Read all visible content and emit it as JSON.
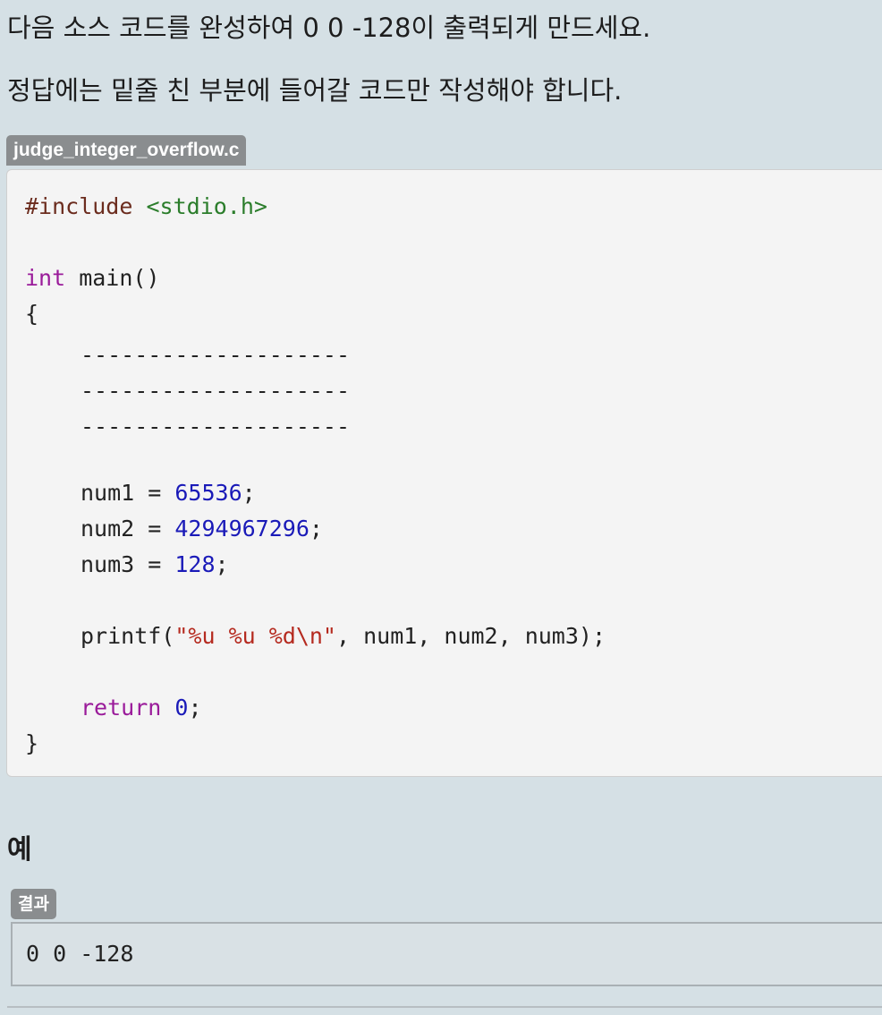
{
  "instructions": {
    "line1": "다음 소스 코드를 완성하여 0 0 -128이 출력되게 만드세요.",
    "line2": "정답에는 밑줄 친 부분에 들어갈 코드만 작성해야 합니다."
  },
  "code": {
    "filename": "judge_integer_overflow.c",
    "include_directive": "#include",
    "include_header": "<stdio.h>",
    "main_type": "int",
    "main_sig": " main()",
    "open_brace": "{",
    "blanks": [
      "--------------------",
      "--------------------",
      "--------------------"
    ],
    "assign1_var": "num1 = ",
    "assign1_val": "65536",
    "assign2_var": "num2 = ",
    "assign2_val": "4294967296",
    "assign3_var": "num3 = ",
    "assign3_val": "128",
    "semicolon": ";",
    "printf_fn": "printf(",
    "printf_fmt": "\"%u %u %d\\n\"",
    "printf_args": ", num1, num2, num3);",
    "return_kw": "return",
    "return_val": "0",
    "close_brace": "}"
  },
  "example": {
    "title": "예",
    "result_label": "결과",
    "result_output": "0 0 -128"
  },
  "colors": {
    "background": "#d5e0e5",
    "code_background": "#f4f4f4",
    "tag_background": "#8a8d8f",
    "keyword": "#9a1b9a",
    "number": "#1a1ab8",
    "string": "#b52a1f",
    "include_string": "#2b7d2b"
  }
}
